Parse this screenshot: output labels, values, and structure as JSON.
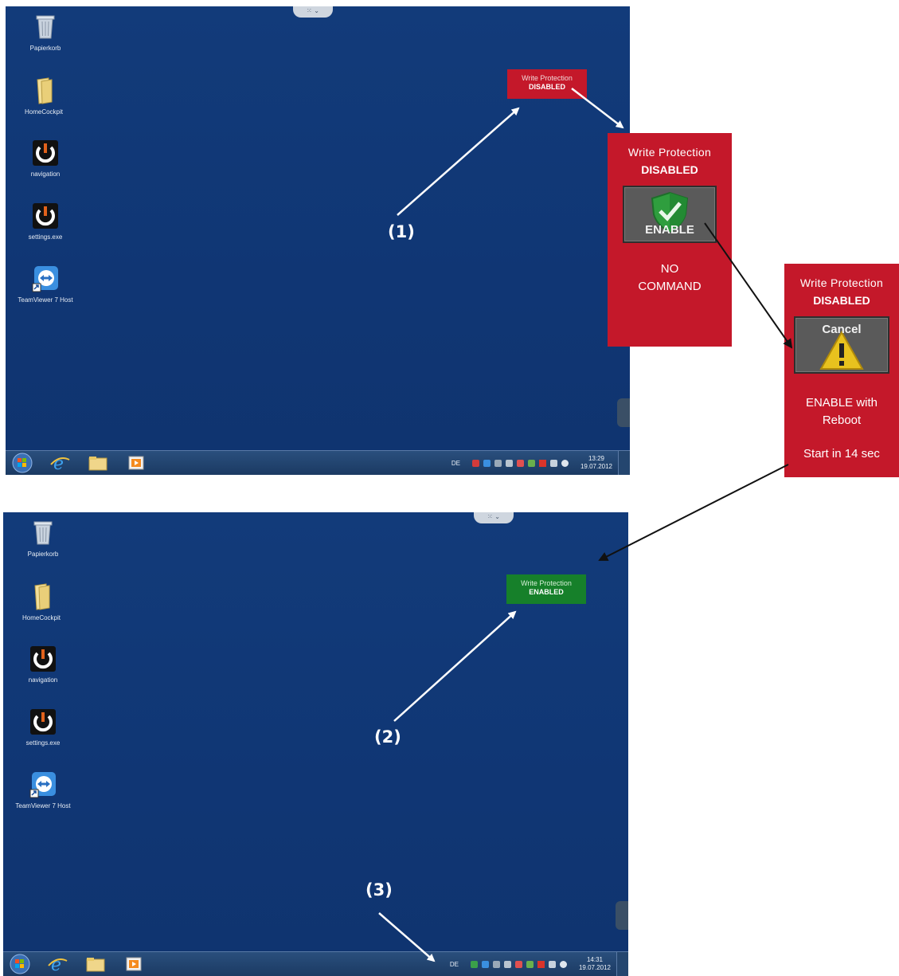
{
  "screens": [
    {
      "icons": [
        {
          "label": "Papierkorb",
          "icon": "recycle-bin-icon"
        },
        {
          "label": "HomeCockpit",
          "icon": "folder-icon"
        },
        {
          "label": "navigation",
          "icon": "power-icon"
        },
        {
          "label": "settings.exe",
          "icon": "power-icon"
        },
        {
          "label": "TeamViewer 7 Host",
          "icon": "teamviewer-icon"
        }
      ],
      "badge": {
        "line1": "Write Protection",
        "line2": "DISABLED",
        "color": "#c4182a"
      },
      "tray": {
        "lang": "DE",
        "time": "13:29",
        "date": "19.07.2012"
      }
    },
    {
      "icons": [
        {
          "label": "Papierkorb",
          "icon": "recycle-bin-icon"
        },
        {
          "label": "HomeCockpit",
          "icon": "folder-icon"
        },
        {
          "label": "navigation",
          "icon": "power-icon"
        },
        {
          "label": "settings.exe",
          "icon": "power-icon"
        },
        {
          "label": "TeamViewer 7 Host",
          "icon": "teamviewer-icon"
        }
      ],
      "badge": {
        "line1": "Write Protection",
        "line2": "ENABLED",
        "color": "#16802a"
      },
      "tray": {
        "lang": "DE",
        "time": "14:31",
        "date": "19.07.2012"
      }
    }
  ],
  "panel_enable": {
    "title": "Write Protection",
    "status": "DISABLED",
    "button": "ENABLE",
    "desc1": "NO",
    "desc2": "COMMAND"
  },
  "panel_cancel": {
    "title": "Write Protection",
    "status": "DISABLED",
    "button": "Cancel",
    "desc1": "ENABLE with",
    "desc2": "Reboot",
    "countdown": "Start in 14 sec"
  },
  "callouts": {
    "one": "(1)",
    "two": "(2)",
    "three": "(3)"
  },
  "colors": {
    "desktop": "#113a78",
    "alert_red": "#c4182a",
    "ok_green": "#16802a"
  }
}
